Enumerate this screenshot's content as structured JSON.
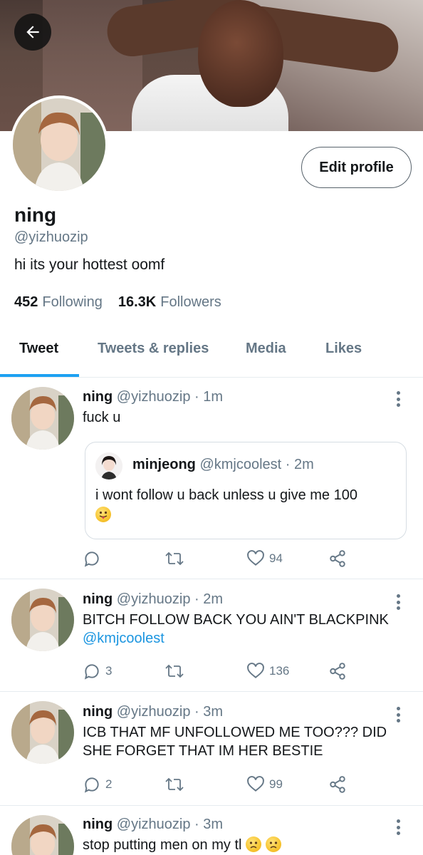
{
  "profile": {
    "name": "ning",
    "handle": "@yizhuozip",
    "bio": "hi its your hottest oomf",
    "following_count": "452",
    "following_label": "Following",
    "followers_count": "16.3K",
    "followers_label": "Followers",
    "edit_label": "Edit profile"
  },
  "tabs": [
    {
      "label": "Tweet",
      "active": true
    },
    {
      "label": "Tweets & replies",
      "active": false
    },
    {
      "label": "Media",
      "active": false
    },
    {
      "label": "Likes",
      "active": false
    }
  ],
  "tweets": [
    {
      "name": "ning",
      "handle": "@yizhuozip",
      "time": "· 1m",
      "text": "fuck u",
      "quote": {
        "name": "minjeong",
        "handle": "@kmjcoolest",
        "time": "· 2m",
        "text": "i wont follow u back unless u give me 100"
      },
      "replies": "",
      "retweets": "",
      "likes": "94"
    },
    {
      "name": "ning",
      "handle": "@yizhuozip",
      "time": "· 2m",
      "text": "BITCH FOLLOW BACK YOU AIN'T BLACKPINK",
      "mention": "@kmjcoolest",
      "replies": "3",
      "retweets": "",
      "likes": "136"
    },
    {
      "name": "ning",
      "handle": "@yizhuozip",
      "time": "· 3m",
      "text": "ICB THAT MF UNFOLLOWED ME TOO??? DID SHE FORGET THAT IM HER BESTIE",
      "replies": "2",
      "retweets": "",
      "likes": "99"
    },
    {
      "name": "ning",
      "handle": "@yizhuozip",
      "time": "· 3m",
      "text": "stop putting men on my tl"
    }
  ],
  "colors": {
    "accent": "#1da1f2",
    "muted": "#657786",
    "link": "#1b95e0"
  }
}
